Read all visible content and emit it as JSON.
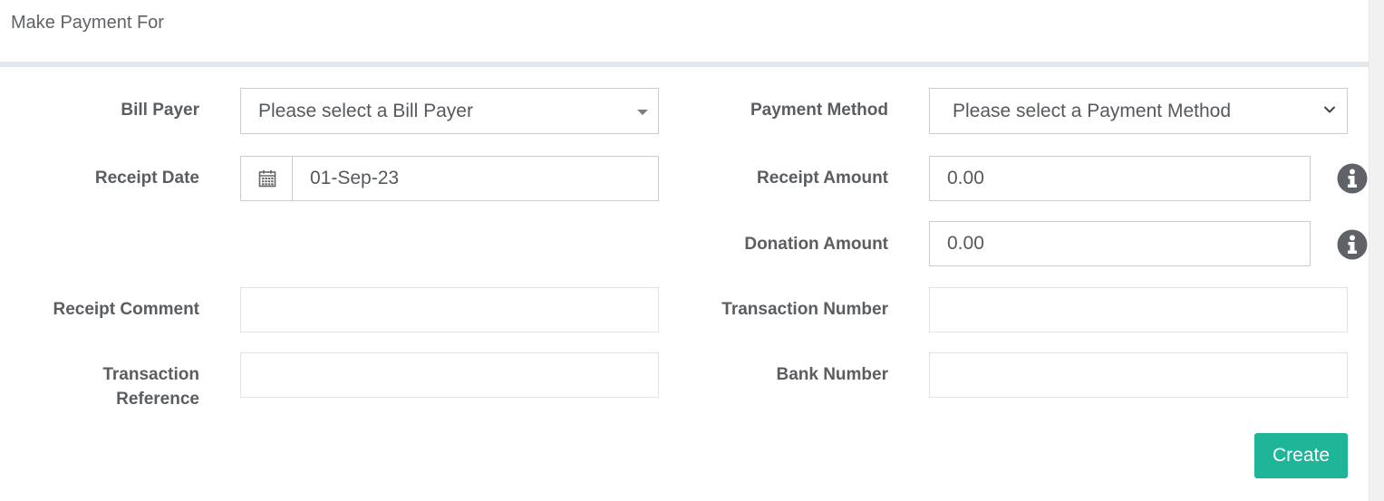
{
  "panel": {
    "title": "Make Payment For"
  },
  "form": {
    "bill_payer": {
      "label": "Bill Payer",
      "value": "Please select a Bill Payer"
    },
    "payment_method": {
      "label": "Payment Method",
      "value": "Please select a Payment Method"
    },
    "receipt_date": {
      "label": "Receipt Date",
      "value": "01-Sep-23"
    },
    "receipt_amount": {
      "label": "Receipt Amount",
      "value": "0.00"
    },
    "donation_amount": {
      "label": "Donation Amount",
      "value": "0.00"
    },
    "receipt_comment": {
      "label": "Receipt Comment",
      "value": ""
    },
    "transaction_number": {
      "label": "Transaction Number",
      "value": ""
    },
    "transaction_reference": {
      "label_line1": "Transaction",
      "label_line2": "Reference",
      "value": ""
    },
    "bank_number": {
      "label": "Bank Number",
      "value": ""
    }
  },
  "actions": {
    "create_label": "Create"
  },
  "colors": {
    "accent": "#1fb598",
    "info_icon": "#5f6266",
    "divider": "#e3e8ee"
  },
  "icons": {
    "calendar": "calendar-icon",
    "info": "info-icon",
    "dropdown": "caret-down-icon"
  }
}
